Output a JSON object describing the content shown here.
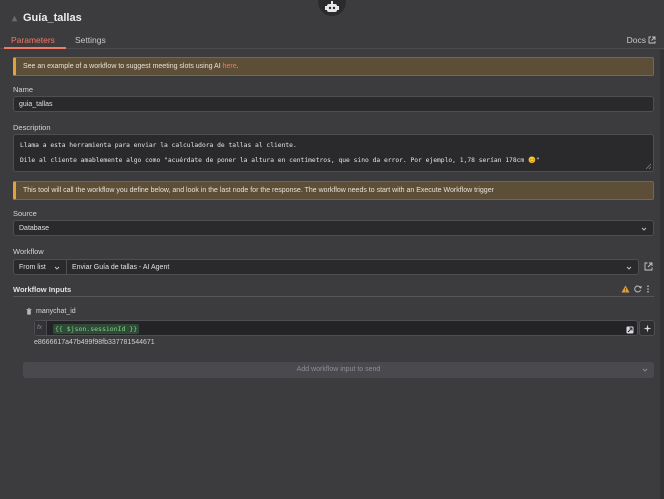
{
  "header": {
    "title": "Guía_tallas",
    "node_icon": "node-icon",
    "agent_icon": "robot-icon"
  },
  "tabs": [
    {
      "label": "Parameters",
      "active": true
    },
    {
      "label": "Settings",
      "active": false
    }
  ],
  "docs": {
    "label": "Docs",
    "icon": "external-link-icon"
  },
  "notice_top": {
    "text": "See an example of a workflow to suggest meeting slots using AI ",
    "link_text": "here",
    "suffix": "."
  },
  "name": {
    "label": "Name",
    "value": "guia_tallas"
  },
  "description": {
    "label": "Description",
    "line1": "Llama a esta herramienta para enviar la calculadora de tallas al cliente.",
    "line2": "Dile al cliente amablemente algo como \"acuérdate de poner la altura en centímetros, que sino da error. Por ejemplo, 1,78 serían 178cm 😊\""
  },
  "notice_tool": {
    "text": "This tool will call the workflow you define below, and look in the last node for the response. The workflow needs to start with an Execute Workflow trigger"
  },
  "source": {
    "label": "Source",
    "value": "Database"
  },
  "workflow": {
    "label": "Workflow",
    "mode": "From list",
    "value": "Enviar Guía de tallas - AI Agent"
  },
  "workflow_inputs": {
    "label": "Workflow Inputs",
    "items": [
      {
        "name": "manychat_id",
        "expression": "{{ $json.sessionId }}",
        "result": "e8666617a47b499f98fb337781544671"
      }
    ],
    "add_label": "Add workflow input to send"
  },
  "colors": {
    "accent": "#f07a63",
    "warning": "#e0a23a",
    "expression": "#7fd68a",
    "background": "#3c3c3f"
  }
}
